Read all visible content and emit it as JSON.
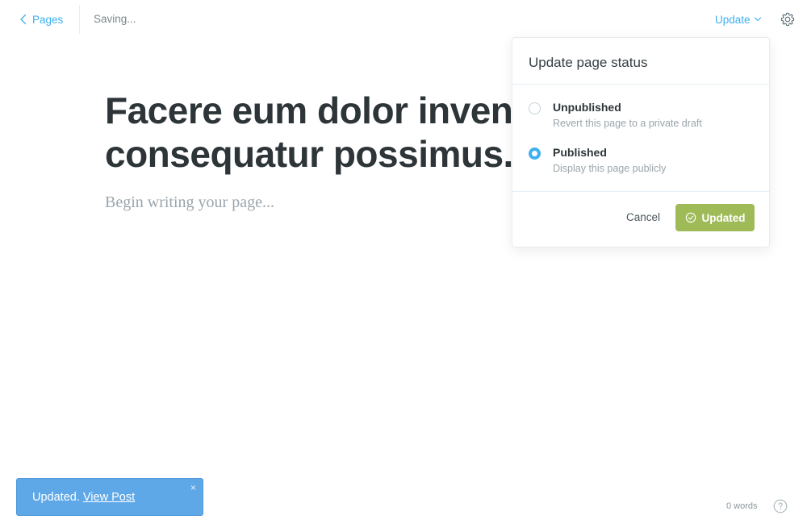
{
  "topbar": {
    "back_label": "Pages",
    "status_text": "Saving...",
    "update_label": "Update",
    "settings_icon": "gear-icon"
  },
  "editor": {
    "title": "Facere eum dolor inventore\nconsequatur possimus.",
    "body_placeholder": "Begin writing your page..."
  },
  "status_popover": {
    "title": "Update page status",
    "options": [
      {
        "label": "Unpublished",
        "description": "Revert this page to a private draft",
        "selected": false
      },
      {
        "label": "Published",
        "description": "Display this page publicly",
        "selected": true
      }
    ],
    "cancel_label": "Cancel",
    "confirm_label": "Updated"
  },
  "toast": {
    "message": "Updated.",
    "link_label": "View Post",
    "close_glyph": "×"
  },
  "footer": {
    "word_count": "0 words",
    "help_icon": "help-circle-icon"
  },
  "colors": {
    "accent": "#3eb0ef",
    "success": "#9fbb58",
    "toast": "#5fa8e8"
  }
}
